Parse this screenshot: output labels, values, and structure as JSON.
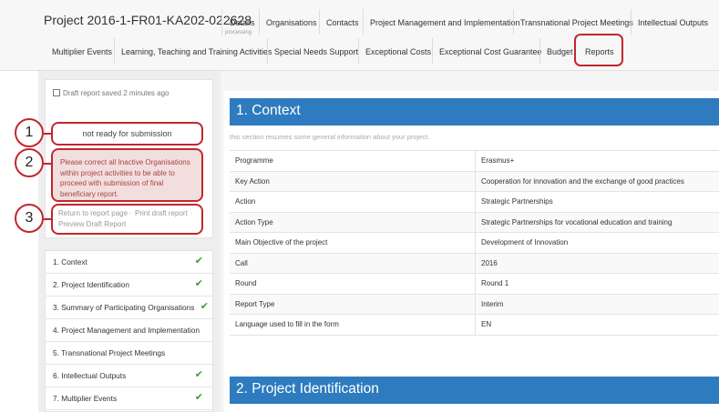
{
  "project": {
    "title": "Project 2016-1-FR01-KA202-022628",
    "status": "processing"
  },
  "tabs_row1": [
    "Details",
    "Organisations",
    "Contacts",
    "Project Management and Implementation",
    "Transnational Project Meetings",
    "Intellectual Outputs"
  ],
  "tabs_row2": [
    "Multiplier Events",
    "Learning, Teaching and Training Activities",
    "Special Needs Support",
    "Exceptional Costs",
    "Exceptional Cost Guarantee",
    "Budget",
    "Reports"
  ],
  "sidebar": {
    "draft_saved": "Draft report saved 2 minutes ago",
    "status_label": "not ready for submission",
    "error_message": "Please correct all Inactive Organisations within project activities to be able to proceed with submission of final beneficiary report.",
    "links": {
      "return": "Return to report page",
      "print": "Print draft report",
      "preview": "Preview Draft Report"
    },
    "menu": [
      {
        "label": "1. Context",
        "done": true
      },
      {
        "label": "2. Project Identification",
        "done": true
      },
      {
        "label": "3. Summary of Participating Organisations",
        "done": true
      },
      {
        "label": "4. Project Management and Implementation",
        "done": false
      },
      {
        "label": "5. Transnational Project Meetings",
        "done": false
      },
      {
        "label": "6. Intellectual Outputs",
        "done": true
      },
      {
        "label": "7. Multiplier Events",
        "done": true
      }
    ]
  },
  "callouts": [
    "1",
    "2",
    "3"
  ],
  "context": {
    "heading": "1. Context",
    "intro": "this section resumes some general information about your project.",
    "rows": [
      {
        "key": "Programme",
        "value": "Erasmus+"
      },
      {
        "key": "Key Action",
        "value": "Cooperation for innovation and the exchange of good practices"
      },
      {
        "key": "Action",
        "value": "Strategic Partnerships"
      },
      {
        "key": "Action Type",
        "value": "Strategic Partnerships for vocational education and training"
      },
      {
        "key": "Main Objective of the project",
        "value": "Development of Innovation"
      },
      {
        "key": "Call",
        "value": "2016"
      },
      {
        "key": "Round",
        "value": "Round 1"
      },
      {
        "key": "Report Type",
        "value": "Interim"
      },
      {
        "key": "Language used to fill in the form",
        "value": "EN"
      }
    ]
  },
  "identification": {
    "heading": "2. Project Identification"
  },
  "colors": {
    "accent": "#2e7bbf",
    "highlight": "#c1272d",
    "error_bg": "#f2dede",
    "error_text": "#a94442",
    "check": "#3c9a3c"
  },
  "icons": {
    "saved": "save-icon",
    "done": "check-icon"
  }
}
